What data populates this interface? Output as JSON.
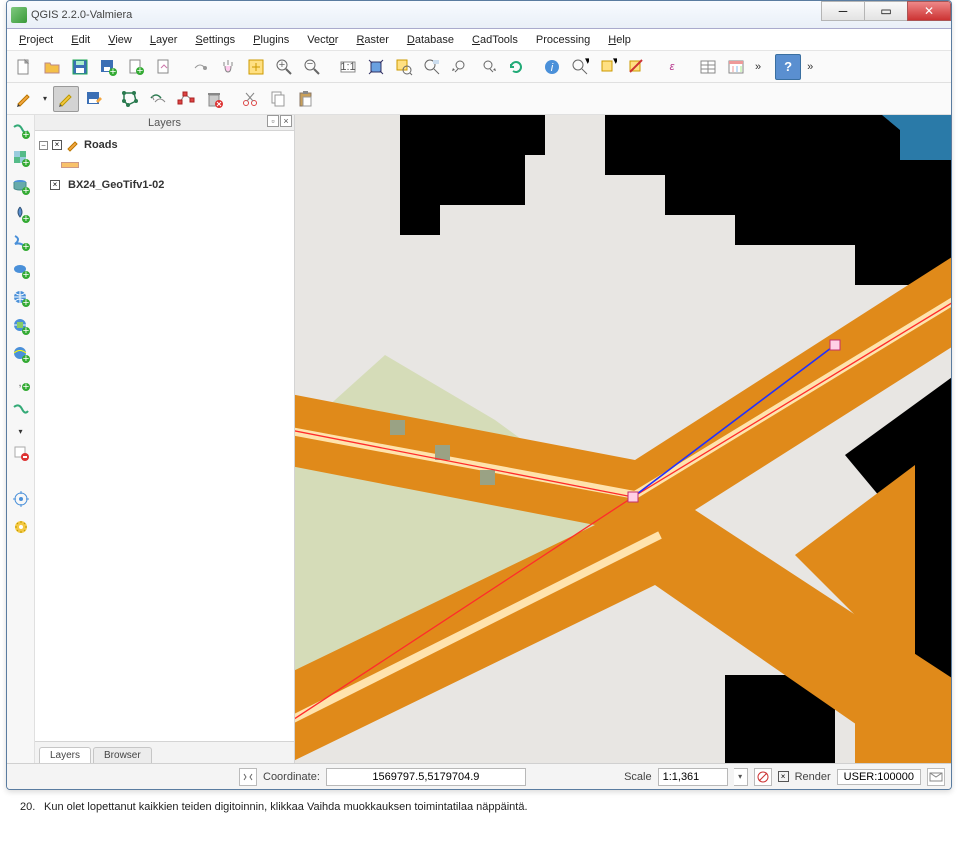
{
  "window": {
    "title": "QGIS 2.2.0-Valmiera"
  },
  "menu": {
    "items": [
      "Project",
      "Edit",
      "View",
      "Layer",
      "Settings",
      "Plugins",
      "Vector",
      "Raster",
      "Database",
      "CadTools",
      "Processing",
      "Help"
    ]
  },
  "layers_panel": {
    "title": "Layers",
    "items": [
      {
        "name": "Roads",
        "checked": true
      },
      {
        "name": "BX24_GeoTifv1-02",
        "checked": true
      }
    ],
    "tabs": [
      "Layers",
      "Browser"
    ]
  },
  "status": {
    "coord_label": "Coordinate:",
    "coord_value": "1569797.5,5179704.9",
    "scale_label": "Scale",
    "scale_value": "1:1,361",
    "render_label": "Render",
    "crs_label": "USER:100000"
  },
  "caption": {
    "num": "20.",
    "text": "Kun olet lopettanut kaikkien teiden digitoinnin, klikkaa Vaihda muokkauksen toimintatilaa näppäintä."
  }
}
